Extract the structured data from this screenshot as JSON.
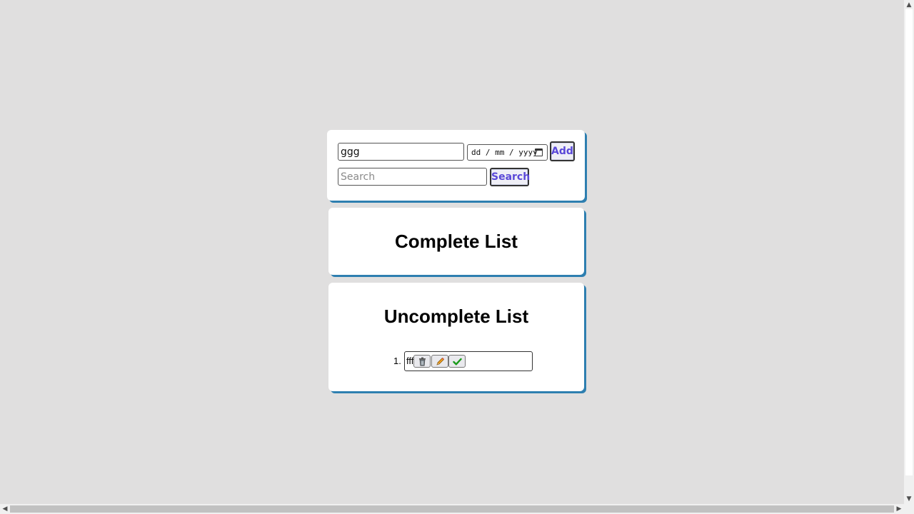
{
  "form": {
    "task_value": "ggg",
    "task_placeholder": "",
    "date_placeholder": "dd / mm / yyyy",
    "add_label": "Add",
    "search_placeholder": "Search",
    "search_value": "",
    "search_label": "Search"
  },
  "complete_list": {
    "title": "Complete List",
    "items": []
  },
  "uncomplete_list": {
    "title": "Uncomplete List",
    "items": [
      {
        "number": "1.",
        "text": "fff"
      }
    ]
  },
  "icons": {
    "delete": "trash-icon",
    "edit": "pencil-icon",
    "done": "checkmark-icon",
    "date": "calendar-icon"
  },
  "colors": {
    "page_bg": "#e0dfdf",
    "card_bg": "#ffffff",
    "card_shadow": "#2e7fb0",
    "button_text": "#5a48d8",
    "check_green": "#1a9a1a",
    "pencil_orange": "#e08a00"
  }
}
